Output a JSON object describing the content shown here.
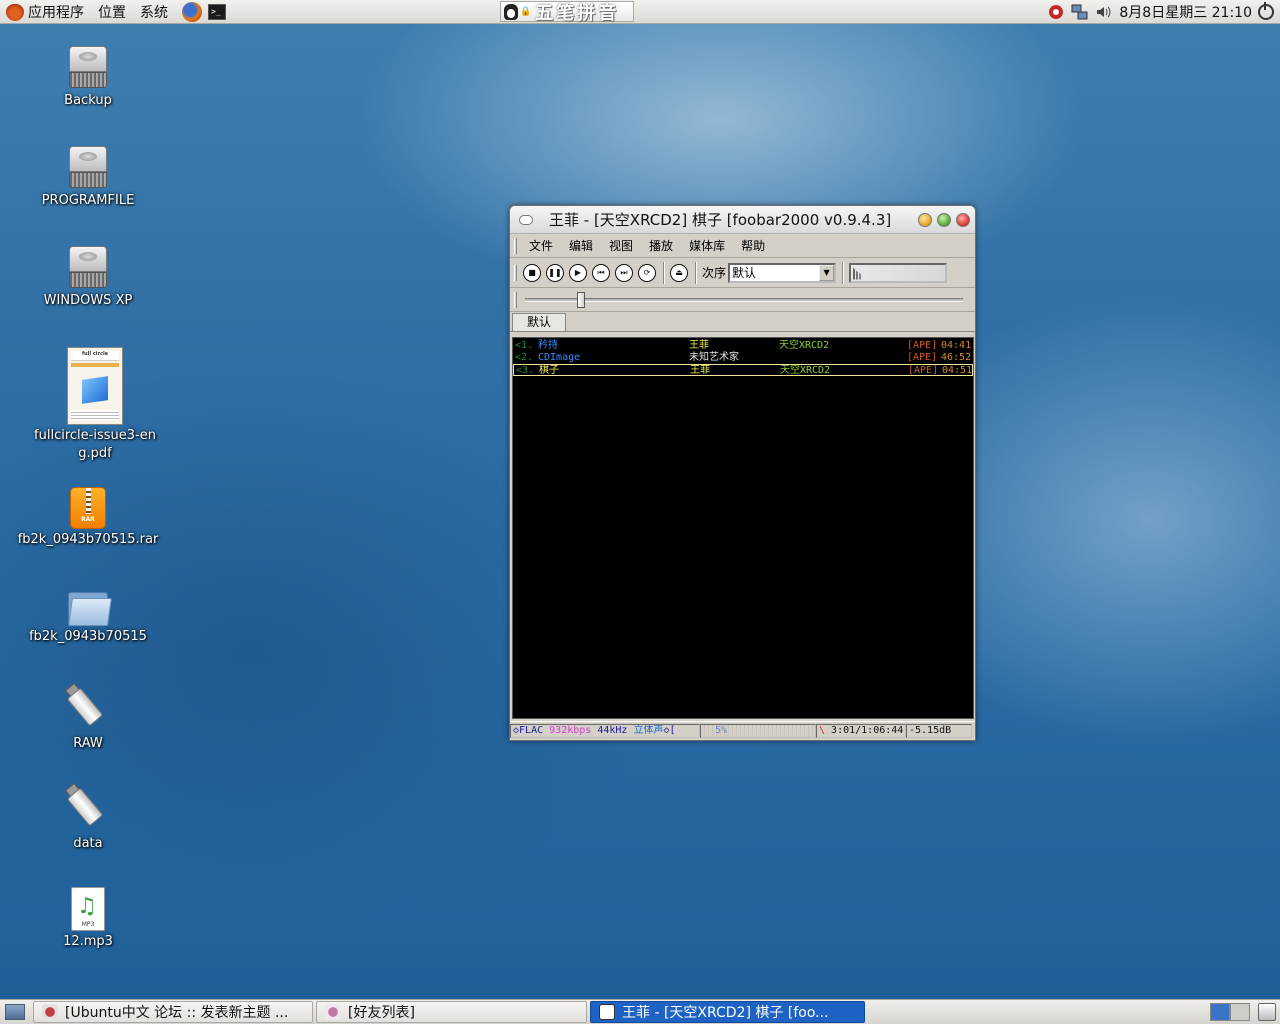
{
  "top_panel": {
    "menus": [
      "应用程序",
      "位置",
      "系统"
    ],
    "ime_text": "五笔拼音",
    "clock": "8月8日星期三 21:10"
  },
  "desktop_icons": [
    {
      "label": "Backup",
      "icon": "hard-drive-icon"
    },
    {
      "label": "PROGRAMFILE",
      "icon": "hard-drive-icon"
    },
    {
      "label": "WINDOWS XP",
      "icon": "hard-drive-icon"
    },
    {
      "label": "fullcircle-issue3-eng.pdf",
      "icon": "pdf-thumbnail-icon"
    },
    {
      "label": "fb2k_0943b70515.rar",
      "icon": "rar-archive-icon"
    },
    {
      "label": "fb2k_0943b70515",
      "icon": "folder-icon"
    },
    {
      "label": "RAW",
      "icon": "usb-drive-icon"
    },
    {
      "label": "data",
      "icon": "usb-drive-icon"
    },
    {
      "label": "12.mp3",
      "icon": "mp3-file-icon"
    }
  ],
  "pdf_thumb_header": "full circle",
  "rar_badge": "RAR",
  "mp3_badge": "MP3",
  "foobar": {
    "title": "王菲 - [天空XRCD2] 棋子   [foobar2000 v0.9.4.3]",
    "menus": [
      "文件",
      "编辑",
      "视图",
      "播放",
      "媒体库",
      "帮助"
    ],
    "order_label": "次序",
    "order_value": "默认",
    "seek_position": 0.12,
    "tab_label": "默认",
    "playlist": [
      {
        "num": "<1.",
        "title": "矜持",
        "artist": "王菲",
        "album": "天空XRCD2",
        "format": "[APE]",
        "duration": "04:41",
        "title_color": "#3a8cff",
        "artist_color": "#e8e848",
        "active": false
      },
      {
        "num": "<2.",
        "title": "CDImage",
        "artist": "未知艺术家",
        "album": "",
        "format": "[APE]",
        "duration": "46:52",
        "title_color": "#3a8cff",
        "artist_color": "#e6e6e6",
        "active": false
      },
      {
        "num": "<3.",
        "title": "棋子",
        "artist": "王菲",
        "album": "天空XRCD2",
        "format": "[APE]",
        "duration": "04:51",
        "title_color": "#f2ee5a",
        "artist_color": "#f2ee5a",
        "active": true
      }
    ],
    "status": {
      "codec": "FLAC",
      "bitrate": "932kbps",
      "samplerate": "44kHz",
      "channels": "立体声",
      "progress_percent": "5%",
      "time": "3:01/1:06:44",
      "gain": "-5.15dB"
    }
  },
  "taskbar": {
    "tasks": [
      {
        "label": "[Ubuntu中文 论坛 :: 发表新主题 ...",
        "active": false
      },
      {
        "label": "[好友列表]",
        "active": false
      },
      {
        "label": "王菲 - [天空XRCD2] 棋子   [foo...",
        "active": true
      }
    ]
  },
  "colors": {
    "task_active": "#1e63c4",
    "playlist_bg": "#000000",
    "status_codec": "#1a1a9a",
    "status_bitrate": "#d040d0"
  }
}
